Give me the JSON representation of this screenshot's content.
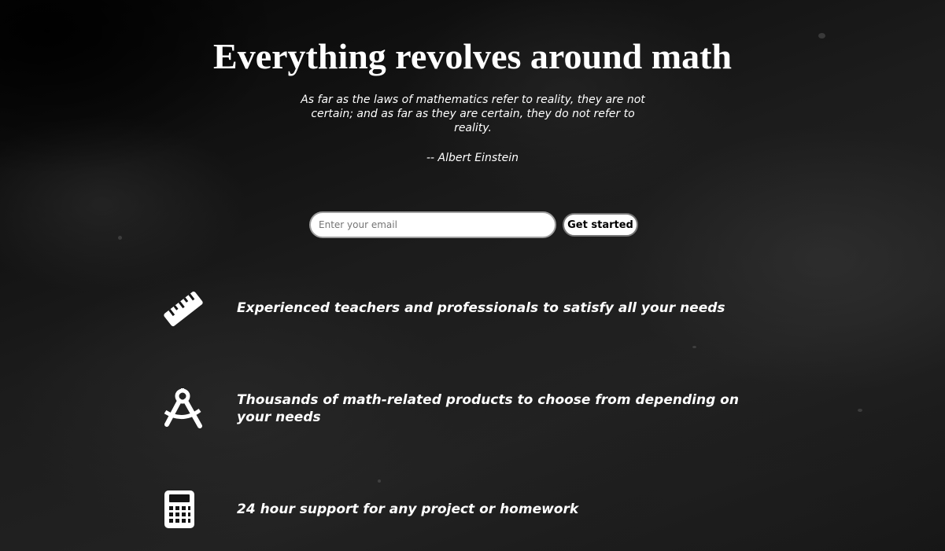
{
  "hero": {
    "title": "Everything revolves around math",
    "quote": "As far as the laws of mathematics refer to reality, they are not certain; and as far as they are certain, they do not refer to reality.",
    "author": "-- Albert Einstein"
  },
  "signup": {
    "email_placeholder": "Enter your email",
    "email_value": "",
    "button_label": "Get started"
  },
  "features": [
    {
      "icon": "ruler-icon",
      "text": "Experienced teachers and professionals to satisfy all your needs"
    },
    {
      "icon": "drafting-compass-icon",
      "text": "Thousands of math-related products to choose from depending on your needs"
    },
    {
      "icon": "calculator-icon",
      "text": "24 hour support for any project or homework"
    }
  ],
  "colors": {
    "background": "#141414",
    "text": "#ffffff",
    "input_bg": "#ffffff",
    "button_bg": "#ffffff"
  }
}
